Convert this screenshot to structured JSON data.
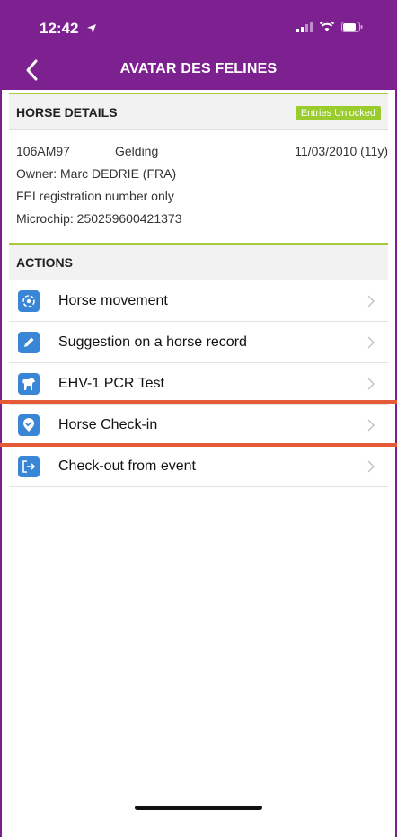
{
  "status_bar": {
    "time": "12:42"
  },
  "nav": {
    "title": "AVATAR DES FELINES"
  },
  "horse_details": {
    "header": "HORSE DETAILS",
    "badge": "Entries Unlocked",
    "id": "106AM97",
    "sex": "Gelding",
    "birth": "11/03/2010 (11y)",
    "owner": "Owner: Marc DEDRIE (FRA)",
    "registration": "FEI registration number only",
    "microchip": "Microchip: 250259600421373"
  },
  "actions": {
    "header": "ACTIONS",
    "items": [
      {
        "label": "Horse movement",
        "icon": "target-icon"
      },
      {
        "label": "Suggestion on a horse record",
        "icon": "pencil-icon"
      },
      {
        "label": "EHV-1 PCR Test",
        "icon": "horse-icon"
      },
      {
        "label": "Horse Check-in",
        "icon": "location-check-icon"
      },
      {
        "label": "Check-out from event",
        "icon": "exit-icon"
      }
    ]
  },
  "colors": {
    "primary": "#7e2190",
    "accent_green": "#9bcc2e",
    "icon_blue": "#3a86d6",
    "highlight": "#e55a37"
  }
}
